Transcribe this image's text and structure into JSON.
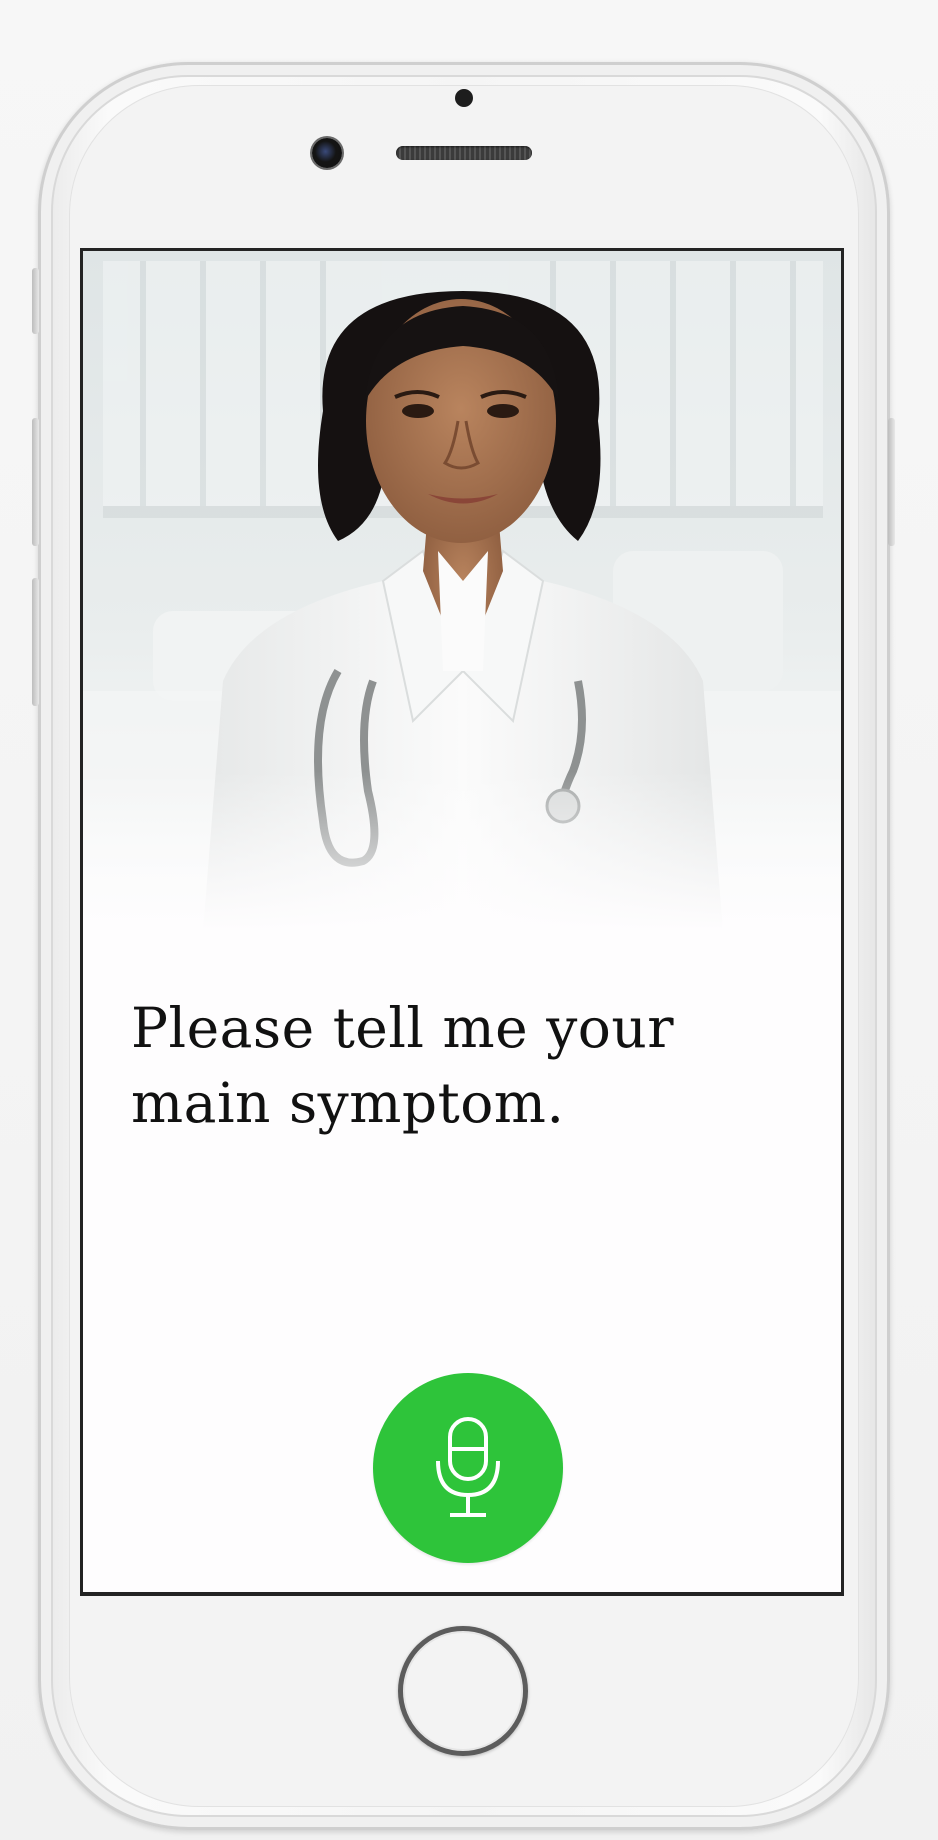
{
  "assistant": {
    "prompt_text": "Please tell me your main symptom."
  },
  "mic_button": {
    "icon": "microphone-icon",
    "color": "#2ec43a"
  },
  "device": {
    "home_button_icon": "home-button",
    "camera_icon": "front-camera"
  }
}
